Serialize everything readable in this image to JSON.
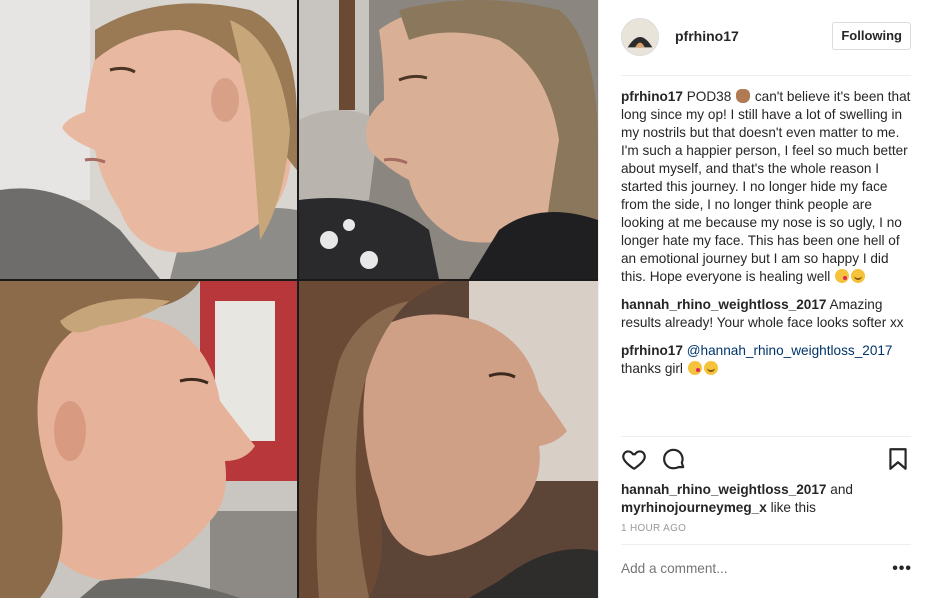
{
  "post": {
    "username": "pfrhino17",
    "follow_label": "Following"
  },
  "comments": [
    {
      "user": "pfrhino17",
      "text_a": " POD38 ",
      "text_b": " can't believe it's been that long since my op! I still have a lot of swelling in my nostrils but that doesn't even matter to me. I'm such a happier person, I feel so much better about myself, and that's the whole reason I started this journey. I no longer hide my face from the side, I no longer think people are looking at me because my nose is so ugly, I no longer hate my face. This has been one hell of an emotional journey but I am so happy I did this. Hope everyone is healing well "
    },
    {
      "user": "hannah_rhino_weightloss_2017",
      "text": " Amazing results already! Your whole face looks softer xx"
    },
    {
      "user": "pfrhino17",
      "mention": "@hannah_rhino_weightloss_2017",
      "text": " thanks girl "
    }
  ],
  "likes": {
    "user1": "hannah_rhino_weightloss_2017",
    "and": " and ",
    "user2": "myrhinojourneymeg_x",
    "suffix": " like this"
  },
  "timestamp": "1 HOUR AGO",
  "add_comment_placeholder": "Add a comment...",
  "more_label": "•••",
  "icons": {
    "like": "heart-icon",
    "comment": "comment-bubble-icon",
    "save": "bookmark-icon",
    "more": "ellipsis-icon"
  }
}
